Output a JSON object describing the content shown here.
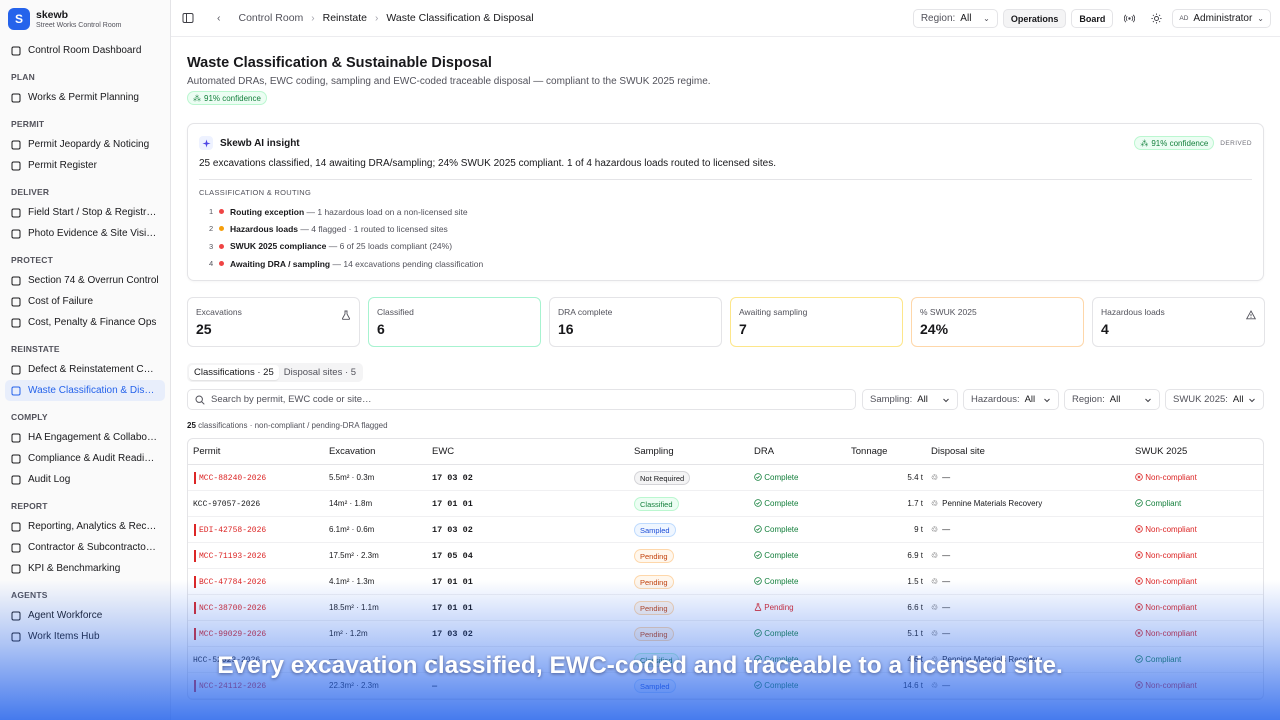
{
  "brand": {
    "name": "skewb",
    "sub": "Street Works Control Room",
    "logo": "S"
  },
  "sidebar": {
    "top": {
      "label": "Control Room Dashboard",
      "icon": "dashboard-icon"
    },
    "sections": [
      {
        "title": "PLAN",
        "items": [
          {
            "label": "Works & Permit Planning",
            "icon": "calendar-icon"
          }
        ]
      },
      {
        "title": "PERMIT",
        "items": [
          {
            "label": "Permit Jeopardy & Noticing",
            "icon": "alert-icon"
          },
          {
            "label": "Permit Register",
            "icon": "clipboard-icon"
          }
        ]
      },
      {
        "title": "DELIVER",
        "items": [
          {
            "label": "Field Start / Stop & Registration",
            "icon": "play-icon"
          },
          {
            "label": "Photo Evidence & Site Visibility",
            "icon": "camera-icon"
          }
        ]
      },
      {
        "title": "PROTECT",
        "items": [
          {
            "label": "Section 74 & Overrun Control",
            "icon": "shield-icon"
          },
          {
            "label": "Cost of Failure",
            "icon": "pound-icon"
          },
          {
            "label": "Cost, Penalty & Finance Ops",
            "icon": "receipt-icon"
          }
        ]
      },
      {
        "title": "REINSTATE",
        "items": [
          {
            "label": "Defect & Reinstatement Control",
            "icon": "layers-icon"
          },
          {
            "label": "Waste Classification & Disposal",
            "icon": "recycle-icon",
            "active": true
          }
        ]
      },
      {
        "title": "COMPLY",
        "items": [
          {
            "label": "HA Engagement & Collaboration",
            "icon": "handshake-icon"
          },
          {
            "label": "Compliance & Audit Readiness",
            "icon": "check-shield-icon"
          },
          {
            "label": "Audit Log",
            "icon": "log-icon"
          }
        ]
      },
      {
        "title": "REPORT",
        "items": [
          {
            "label": "Reporting, Analytics & Records",
            "icon": "chart-icon"
          },
          {
            "label": "Contractor & Subcontractor Performance",
            "icon": "award-icon"
          },
          {
            "label": "KPI & Benchmarking",
            "icon": "trend-icon"
          }
        ]
      },
      {
        "title": "AGENTS",
        "items": [
          {
            "label": "Agent Workforce",
            "icon": "bot-icon"
          },
          {
            "label": "Work Items Hub",
            "icon": "inbox-icon"
          }
        ]
      }
    ]
  },
  "topbar": {
    "crumbs": [
      "Control Room",
      "Reinstate",
      "Waste Classification & Disposal"
    ],
    "region_label": "Region:",
    "region_value": "All",
    "operations": "Operations",
    "board": "Board",
    "user_initials": "AD",
    "user_name": "Administrator"
  },
  "page": {
    "title": "Waste Classification & Sustainable Disposal",
    "subtitle": "Automated DRAs, EWC coding, sampling and EWC-coded traceable disposal — compliant to the SWUK 2025 regime.",
    "confidence": "91% confidence"
  },
  "insight": {
    "title": "Skewb AI insight",
    "confidence": "91% confidence",
    "derived": "DERIVED",
    "text": "25 excavations classified, 14 awaiting DRA/sampling; 24% SWUK 2025 compliant. 1 of 4 hazardous loads routed to licensed sites.",
    "section": "CLASSIFICATION & ROUTING",
    "items": [
      {
        "n": "1",
        "color": "#ef4444",
        "bold": "Routing exception",
        "rest": " — 1 hazardous load on a non-licensed site"
      },
      {
        "n": "2",
        "color": "#f59e0b",
        "bold": "Hazardous loads",
        "rest": " — 4 flagged · 1 routed to licensed sites"
      },
      {
        "n": "3",
        "color": "#ef4444",
        "bold": "SWUK 2025 compliance",
        "rest": " — 6 of 25 loads compliant (24%)"
      },
      {
        "n": "4",
        "color": "#ef4444",
        "bold": "Awaiting DRA / sampling",
        "rest": " — 14 excavations pending classification"
      }
    ]
  },
  "stats": [
    {
      "label": "Excavations",
      "value": "25",
      "icon": "flask-icon",
      "border": "#e4e4e7"
    },
    {
      "label": "Classified",
      "value": "6",
      "border": "#a7f3d0"
    },
    {
      "label": "DRA complete",
      "value": "16",
      "border": "#e4e4e7"
    },
    {
      "label": "Awaiting sampling",
      "value": "7",
      "border": "#fde68a"
    },
    {
      "label": "% SWUK 2025",
      "value": "24%",
      "border": "#fed7aa"
    },
    {
      "label": "Hazardous loads",
      "value": "4",
      "icon": "warning-icon",
      "border": "#e4e4e7"
    }
  ],
  "tabs": [
    {
      "label": "Classifications · 25",
      "active": true
    },
    {
      "label": "Disposal sites · 5",
      "active": false
    }
  ],
  "search": {
    "placeholder": "Search by permit, EWC code or site…"
  },
  "filters": [
    {
      "label": "Sampling:",
      "value": "All"
    },
    {
      "label": "Hazardous:",
      "value": "All"
    },
    {
      "label": "Region:",
      "value": "All"
    },
    {
      "label": "SWUK 2025:",
      "value": "All"
    }
  ],
  "count": {
    "n": "25",
    "rest": " classifications · non-compliant / pending-DRA flagged"
  },
  "table": {
    "headers": [
      "Permit",
      "Excavation",
      "EWC",
      "Sampling",
      "DRA",
      "Tonnage",
      "Disposal site",
      "SWUK 2025"
    ],
    "rows": [
      {
        "permit": "MCC-88240-2026",
        "flag": true,
        "exc": "5.5m² · 0.3m",
        "ewc": "17 03 02",
        "sampling": "Not Required",
        "skind": "nr",
        "dra": "Complete",
        "ton": "5.4 t",
        "site": "—",
        "swuk": "Non-compliant"
      },
      {
        "permit": "KCC-97057-2026",
        "flag": false,
        "exc": "14m² · 1.8m",
        "ewc": "17 01 01",
        "sampling": "Classified",
        "skind": "cl",
        "dra": "Complete",
        "ton": "1.7 t",
        "site": "Pennine Materials Recovery",
        "swuk": "Compliant"
      },
      {
        "permit": "EDI-42758-2026",
        "flag": true,
        "exc": "6.1m² · 0.6m",
        "ewc": "17 03 02",
        "sampling": "Sampled",
        "skind": "sa",
        "dra": "Complete",
        "ton": "9 t",
        "site": "—",
        "swuk": "Non-compliant"
      },
      {
        "permit": "MCC-71193-2026",
        "flag": true,
        "exc": "17.5m² · 2.3m",
        "ewc": "17 05 04",
        "sampling": "Pending",
        "skind": "pe",
        "dra": "Complete",
        "ton": "6.9 t",
        "site": "—",
        "swuk": "Non-compliant"
      },
      {
        "permit": "BCC-47784-2026",
        "flag": true,
        "exc": "4.1m² · 1.3m",
        "ewc": "17 01 01",
        "sampling": "Pending",
        "skind": "pe",
        "dra": "Complete",
        "ton": "1.5 t",
        "site": "—",
        "swuk": "Non-compliant"
      },
      {
        "permit": "NCC-38700-2026",
        "flag": true,
        "exc": "18.5m² · 1.1m",
        "ewc": "17 01 01",
        "sampling": "Pending",
        "skind": "pe",
        "dra": "Pending",
        "ton": "6.6 t",
        "site": "—",
        "swuk": "Non-compliant"
      },
      {
        "permit": "MCC-99029-2026",
        "flag": true,
        "exc": "1m² · 1.2m",
        "ewc": "17 03 02",
        "sampling": "Pending",
        "skind": "pe",
        "dra": "Complete",
        "ton": "5.1 t",
        "site": "—",
        "swuk": "Non-compliant"
      },
      {
        "permit": "HCC-52023-2026",
        "flag": false,
        "exc": "—",
        "ewc": "—",
        "sampling": "Classified",
        "skind": "cl",
        "dra": "Complete",
        "ton": "4.6 t",
        "site": "Pennine Materials Recovery",
        "swuk": "Compliant"
      },
      {
        "permit": "NCC-24112-2026",
        "flag": true,
        "exc": "22.3m² · 2.3m",
        "ewc": "—",
        "sampling": "Sampled",
        "skind": "sa",
        "dra": "Complete",
        "ton": "14.6 t",
        "site": "—",
        "swuk": "Non-compliant"
      }
    ]
  },
  "caption": "Every excavation classified, EWC-coded and traceable to a licensed site."
}
